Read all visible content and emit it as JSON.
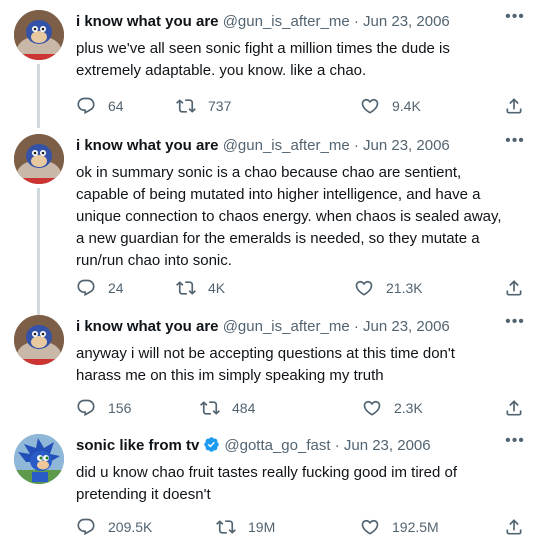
{
  "tweets": [
    {
      "author_name": "i know what you are",
      "author_handle": "@gun_is_after_me",
      "separator": "·",
      "date": "Jun 23, 2006",
      "verified": false,
      "avatar": "sonic-plush-avatar",
      "text": "plus we've all seen sonic fight a million times the dude is\nextremely adaptable. you know. like a chao.",
      "replies": "64",
      "retweets": "737",
      "likes": "9.4K"
    },
    {
      "author_name": "i know what you are",
      "author_handle": "@gun_is_after_me",
      "separator": "·",
      "date": "Jun 23, 2006",
      "verified": false,
      "avatar": "sonic-plush-avatar",
      "text": "ok in summary sonic is a chao because chao are sentient,\ncapable of being mutated into higher intelligence, and have a\nunique connection to chaos energy. when chaos is sealed away,\na new guardian for the emeralds is needed, so they mutate a\nrun/run chao into sonic.",
      "replies": "24",
      "retweets": "4K",
      "likes": "21.3K"
    },
    {
      "author_name": "i know what you are",
      "author_handle": "@gun_is_after_me",
      "separator": "·",
      "date": "Jun 23, 2006",
      "verified": false,
      "avatar": "sonic-plush-avatar",
      "text": "anyway i will not be accepting questions at this time don't\nharass me on this im simply speaking my truth",
      "replies": "156",
      "retweets": "484",
      "likes": "2.3K"
    },
    {
      "author_name": "sonic like from tv",
      "author_handle": "@gotta_go_fast",
      "separator": "·",
      "date": "Jun 23, 2006",
      "verified": true,
      "avatar": "sonic-avatar",
      "text": "did u know chao fruit tastes really fucking good im tired of\npretending it doesn't",
      "replies": "209.5K",
      "retweets": "19M",
      "likes": "192.5M"
    }
  ],
  "icons": {
    "reply": "reply-icon",
    "retweet": "retweet-icon",
    "like": "like-icon",
    "share": "share-icon",
    "more": "more-icon",
    "verified": "verified-badge-icon"
  },
  "colors": {
    "text": "#0f1419",
    "secondary": "#536471",
    "thread_line": "#cfd9de",
    "verified": "#1d9bf0"
  }
}
